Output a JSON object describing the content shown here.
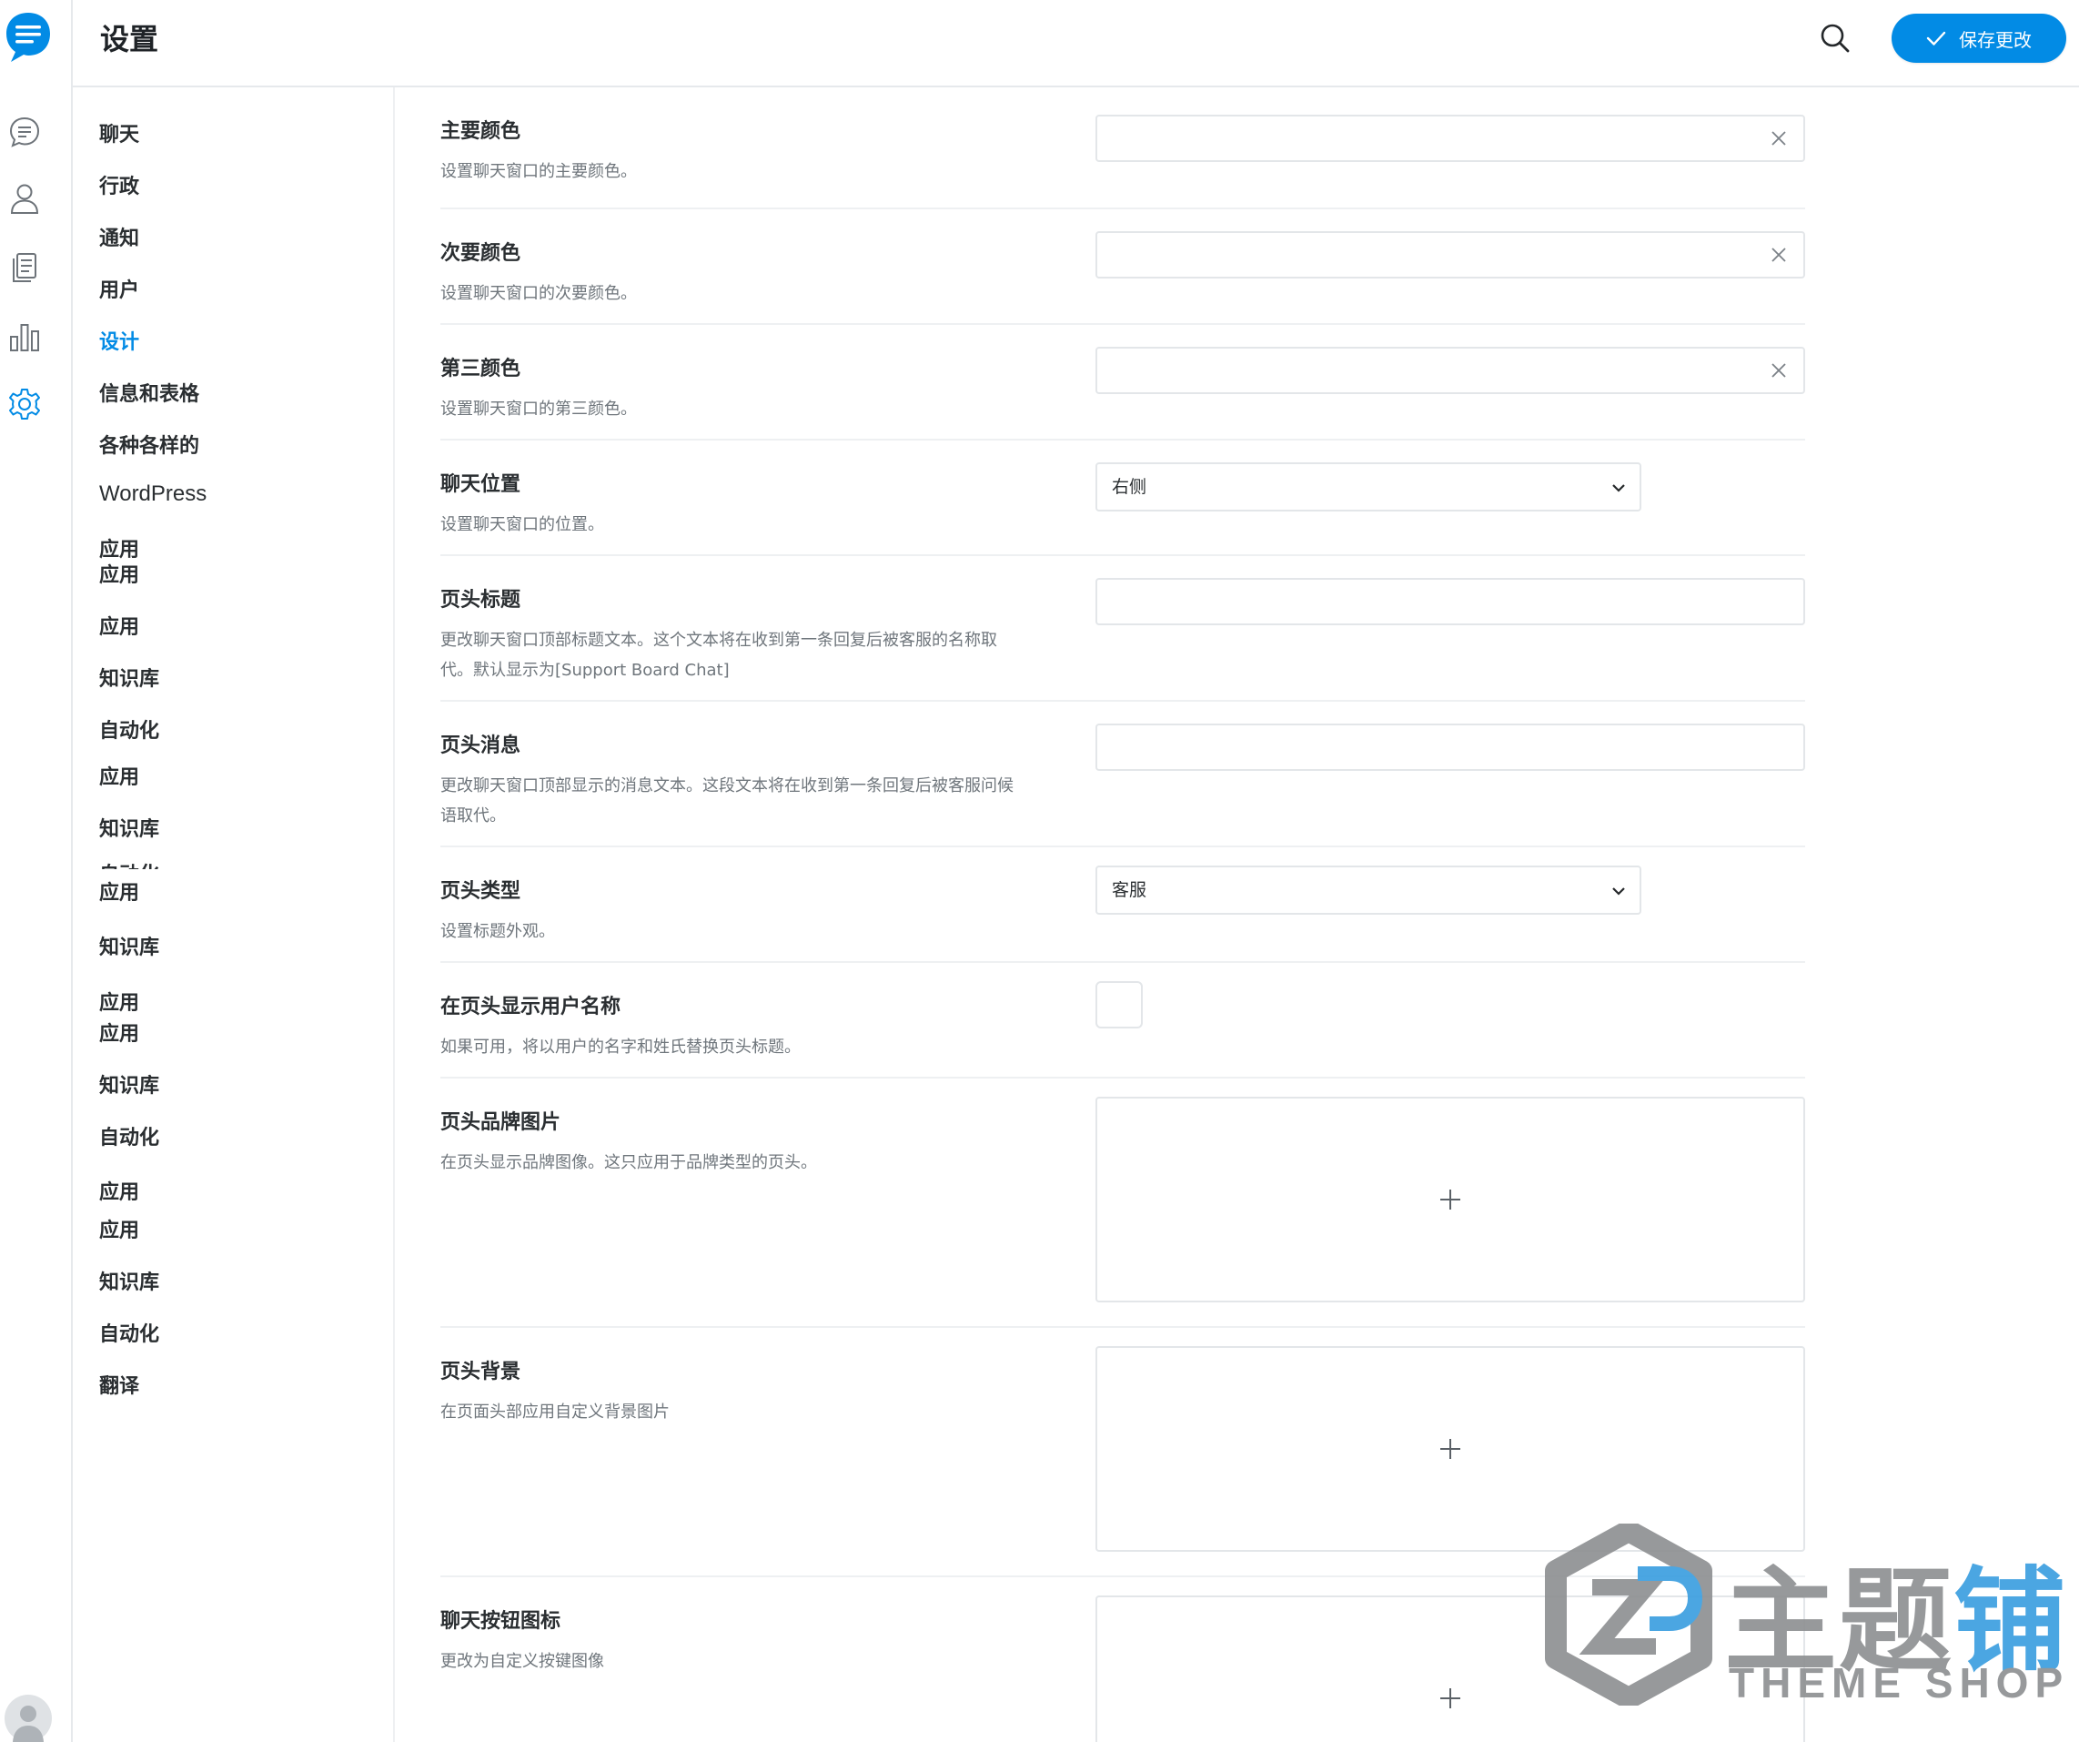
{
  "header": {
    "title": "设置",
    "save_label": "保存更改"
  },
  "colors": {
    "accent": "#028be5",
    "border": "#e3e6e9",
    "text": "#2a2e31",
    "muted": "#6f767c"
  },
  "rail": {
    "icons": [
      "chat-logo-icon",
      "conversations-icon",
      "users-icon",
      "articles-icon",
      "reports-icon",
      "settings-icon",
      "user-avatar"
    ]
  },
  "submenu": {
    "items": [
      {
        "label": "聊天"
      },
      {
        "label": "行政"
      },
      {
        "label": "通知"
      },
      {
        "label": "用户"
      },
      {
        "label": "设计"
      },
      {
        "label": "信息和表格"
      },
      {
        "label": "各种各样的"
      },
      {
        "label": "WordPress"
      },
      {
        "label": "应用"
      },
      {
        "label": "应用"
      },
      {
        "label": "应用"
      },
      {
        "label": "知识库"
      },
      {
        "label": "自动化"
      },
      {
        "label": "应用"
      },
      {
        "label": "知识库"
      },
      {
        "label": "自动化"
      },
      {
        "label": "应用"
      },
      {
        "label": "知识库"
      },
      {
        "label": "应用"
      },
      {
        "label": "应用"
      },
      {
        "label": "知识库"
      },
      {
        "label": "自动化"
      },
      {
        "label": "应用"
      },
      {
        "label": "应用"
      },
      {
        "label": "知识库"
      },
      {
        "label": "自动化"
      },
      {
        "label": "翻译"
      }
    ]
  },
  "settings": {
    "primary_color": {
      "title": "主要颜色",
      "desc": "设置聊天窗口的主要颜色。",
      "value": ""
    },
    "secondary_color": {
      "title": "次要颜色",
      "desc": "设置聊天窗口的次要颜色。",
      "value": ""
    },
    "tertiary_color": {
      "title": "第三颜色",
      "desc": "设置聊天窗口的第三颜色。",
      "value": ""
    },
    "chat_position": {
      "title": "聊天位置",
      "desc": "设置聊天窗口的位置。",
      "value": "右侧"
    },
    "header_title": {
      "title": "页头标题",
      "desc": "更改聊天窗口顶部标题文本。这个文本将在收到第一条回复后被客服的名称取代。默认显示为[Support Board Chat]",
      "value": ""
    },
    "header_message": {
      "title": "页头消息",
      "desc": "更改聊天窗口顶部显示的消息文本。这段文本将在收到第一条回复后被客服问候语取代。",
      "value": ""
    },
    "header_type": {
      "title": "页头类型",
      "desc": "设置标题外观。",
      "value": "客服"
    },
    "header_user_name": {
      "title": "在页头显示用户名称",
      "desc": "如果可用，将以用户的名字和姓氏替换页头标题。",
      "checked": false
    },
    "header_brand_image": {
      "title": "页头品牌图片",
      "desc": "在页头显示品牌图像。这只应用于品牌类型的页头。"
    },
    "header_background": {
      "title": "页头背景",
      "desc": "在页面头部应用自定义背景图片"
    },
    "chat_button_icon": {
      "title": "聊天按钮图标",
      "desc": "更改为自定义按键图像"
    }
  },
  "watermark": {
    "cn_prefix": "主题",
    "cn_suffix": "铺",
    "en": "THEME SHOP"
  }
}
